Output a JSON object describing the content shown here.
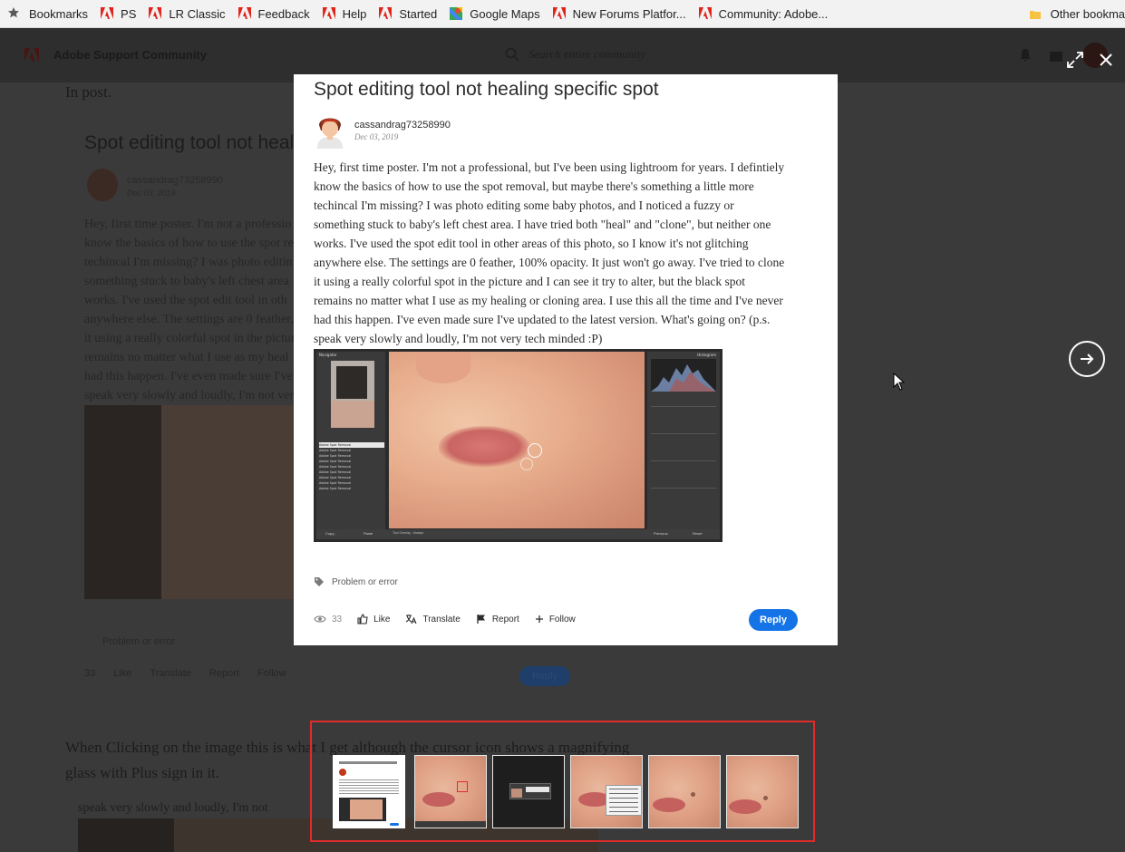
{
  "bookmarks": {
    "label": "Bookmarks",
    "items": [
      {
        "label": "PS",
        "icon": "adobe-icon"
      },
      {
        "label": "LR Classic",
        "icon": "adobe-icon"
      },
      {
        "label": "Feedback",
        "icon": "adobe-icon"
      },
      {
        "label": "Help",
        "icon": "adobe-icon"
      },
      {
        "label": "Started",
        "icon": "adobe-icon"
      },
      {
        "label": "Google Maps",
        "icon": "google-maps-icon"
      },
      {
        "label": "New Forums Platfor...",
        "icon": "adobe-icon"
      },
      {
        "label": "Community: Adobe...",
        "icon": "adobe-icon"
      }
    ],
    "other": "Other bookma"
  },
  "background_page": {
    "brand": "Adobe Support Community",
    "search_placeholder": "Search entire community",
    "in_post": "In post.",
    "post_title": "Spot editing tool not heal",
    "username": "cassandrag73258990",
    "date": "Dec 03, 2019",
    "body_lines": [
      "Hey, first time poster. I'm not a professio",
      "know the basics of how to use the spot re",
      "techincal I'm missing? I was photo editin",
      "something stuck to baby's left chest area",
      "works. I've used the spot edit tool in oth",
      "anywhere else. The settings are 0 feather,",
      "it using a really colorful spot in the pictur",
      "remains no matter what I use as my heal",
      "had this happen. I've even made sure I've",
      "speak very slowly and loudly, I'm not ver"
    ],
    "tag": "Problem or error",
    "views": "33",
    "like": "Like",
    "translate": "Translate",
    "report": "Report",
    "follow": "Follow",
    "reply": "Reply",
    "clicking_line1": "When Clicking on the image this is what I get although the cursor icon shows a magnifying",
    "clicking_line2": "glass with Plus sign in it.",
    "cut_line": "speak very slowly and loudly, I'm not"
  },
  "modal": {
    "title": "Spot editing tool not healing specific spot",
    "username": "cassandrag73258990",
    "date": "Dec 03, 2019",
    "body_lines": [
      "Hey, first time poster. I'm not a professional, but I've been using lightroom for years. I defintiely",
      "know the basics of how to use the spot removal, but maybe there's something a little more",
      "techincal I'm missing? I was photo editing some baby photos, and I noticed a fuzzy or",
      "something stuck to baby's left chest area. I have tried both \"heal\" and \"clone\", but neither one",
      "works. I've used the spot edit tool in other areas of this photo, so I know it's not glitching",
      "anywhere else. The settings are 0 feather, 100% opacity. It just won't go away. I've tried to clone",
      "it using a really colorful spot in the picture and I can see it try to alter, but the black spot",
      "remains no matter what I use as my healing or cloning area. I use this all the time and I've never",
      "had this happen. I've even made sure I've updated to the latest version. What's going on? (p.s.",
      "speak very slowly and loudly, I'm not very tech minded :P)"
    ],
    "tag": "Problem or error",
    "views": "33",
    "like": "Like",
    "translate": "Translate",
    "report": "Report",
    "follow": "Follow",
    "reply": "Reply"
  },
  "lightroom_screenshot": {
    "navigator": "Navigator",
    "histogram": "Histogram",
    "history_items": [
      "Adobe Spot Removal",
      "Adobe Spot Removal",
      "Adobe Spot Removal",
      "Adobe Spot Removal",
      "Adobe Spot Removal",
      "Adobe Spot Removal",
      "Adobe Spot Removal",
      "Adobe Spot Removal",
      "Adobe Spot Removal"
    ],
    "bottom_left": "Copy...",
    "bottom_paste": "Paste",
    "bottom_prev": "Previous",
    "bottom_reset": "Reset",
    "tool_overlay": "Tool Overlay : Always"
  },
  "lightbox": {
    "thumbnails": [
      "post-screenshot",
      "lips-spot",
      "dark-dialog",
      "context-menu",
      "skin-1",
      "skin-2"
    ],
    "selected_index": 0
  },
  "colors": {
    "reply_blue": "#1473e6",
    "strip_border": "#e02b2b",
    "adobe_red": "#e1251b"
  }
}
